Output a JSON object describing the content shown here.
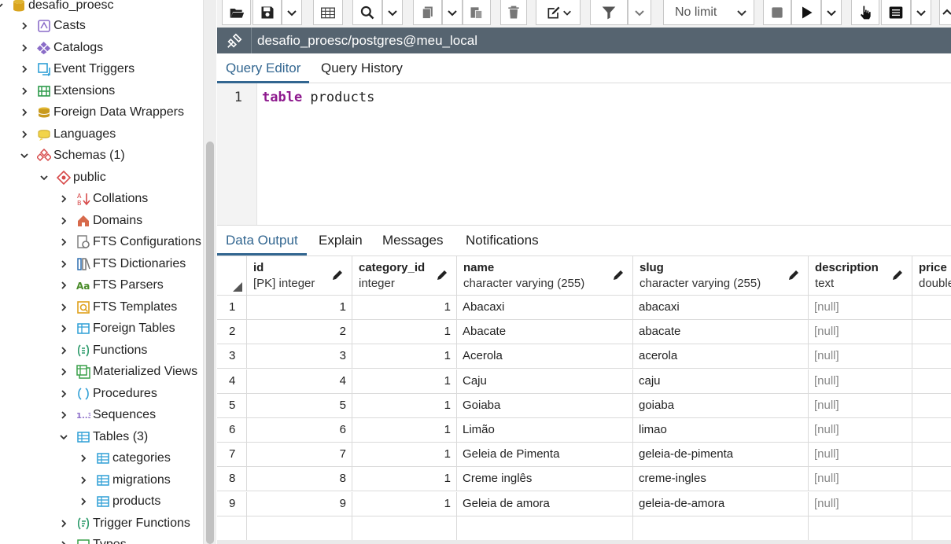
{
  "tree": {
    "items": [
      {
        "label": "desafio_proesc",
        "icon": "database-icon",
        "expanded": true
      },
      {
        "label": "Casts",
        "icon": "casts-icon"
      },
      {
        "label": "Catalogs",
        "icon": "catalogs-icon"
      },
      {
        "label": "Event Triggers",
        "icon": "event-triggers-icon"
      },
      {
        "label": "Extensions",
        "icon": "extensions-icon"
      },
      {
        "label": "Foreign Data Wrappers",
        "icon": "foreign-data-wrappers-icon"
      },
      {
        "label": "Languages",
        "icon": "languages-icon"
      },
      {
        "label": "Schemas (1)",
        "icon": "schemas-icon",
        "expanded": true
      },
      {
        "label": "public",
        "icon": "schema-icon",
        "expanded": true
      },
      {
        "label": "Collations",
        "icon": "collations-icon"
      },
      {
        "label": "Domains",
        "icon": "domains-icon"
      },
      {
        "label": "FTS Configurations",
        "icon": "fts-configurations-icon"
      },
      {
        "label": "FTS Dictionaries",
        "icon": "fts-dictionaries-icon"
      },
      {
        "label": "FTS Parsers",
        "icon": "fts-parsers-icon",
        "icon_text": "Aa"
      },
      {
        "label": "FTS Templates",
        "icon": "fts-templates-icon"
      },
      {
        "label": "Foreign Tables",
        "icon": "foreign-tables-icon"
      },
      {
        "label": "Functions",
        "icon": "functions-icon"
      },
      {
        "label": "Materialized Views",
        "icon": "materialized-views-icon"
      },
      {
        "label": "Procedures",
        "icon": "procedures-icon"
      },
      {
        "label": "Sequences",
        "icon": "sequences-icon",
        "icon_text": "1..3"
      },
      {
        "label": "Tables (3)",
        "icon": "tables-icon",
        "expanded": true
      },
      {
        "label": "categories",
        "icon": "table-icon"
      },
      {
        "label": "migrations",
        "icon": "table-icon"
      },
      {
        "label": "products",
        "icon": "table-icon"
      },
      {
        "label": "Trigger Functions",
        "icon": "trigger-functions-icon"
      },
      {
        "label": "Types",
        "icon": "types-icon"
      }
    ]
  },
  "toolbar": {
    "limit_value": "No limit"
  },
  "connection": {
    "label": "desafio_proesc/postgres@meu_local"
  },
  "editor_tabs": [
    "Query Editor",
    "Query History"
  ],
  "editor": {
    "line_number": "1",
    "keyword": "table",
    "rest": " products"
  },
  "output_tabs": [
    "Data Output",
    "Explain",
    "Messages",
    "Notifications"
  ],
  "grid": {
    "columns": [
      {
        "name": "id",
        "type": "[PK] integer"
      },
      {
        "name": "category_id",
        "type": "integer"
      },
      {
        "name": "name",
        "type": "character varying (255)"
      },
      {
        "name": "slug",
        "type": "character varying (255)"
      },
      {
        "name": "description",
        "type": "text"
      },
      {
        "name": "price",
        "type": "double"
      }
    ],
    "rows": [
      [
        "1",
        "1",
        "1",
        "Abacaxi",
        "abacaxi",
        "[null]"
      ],
      [
        "2",
        "2",
        "1",
        "Abacate",
        "abacate",
        "[null]"
      ],
      [
        "3",
        "3",
        "1",
        "Acerola",
        "acerola",
        "[null]"
      ],
      [
        "4",
        "4",
        "1",
        "Caju",
        "caju",
        "[null]"
      ],
      [
        "5",
        "5",
        "1",
        "Goiaba",
        "goiaba",
        "[null]"
      ],
      [
        "6",
        "6",
        "1",
        "Limão",
        "limao",
        "[null]"
      ],
      [
        "7",
        "7",
        "1",
        "Geleia de Pimenta",
        "geleia-de-pimenta",
        "[null]"
      ],
      [
        "8",
        "8",
        "1",
        "Creme inglês",
        "creme-ingles",
        "[null]"
      ],
      [
        "9",
        "9",
        "1",
        "Geleia de amora",
        "geleia-de-amora",
        "[null]"
      ]
    ]
  },
  "colors": {
    "accent": "#326690",
    "connection_bar": "#566470",
    "keyword": "#8e1a8e",
    "null_text": "#888888"
  }
}
